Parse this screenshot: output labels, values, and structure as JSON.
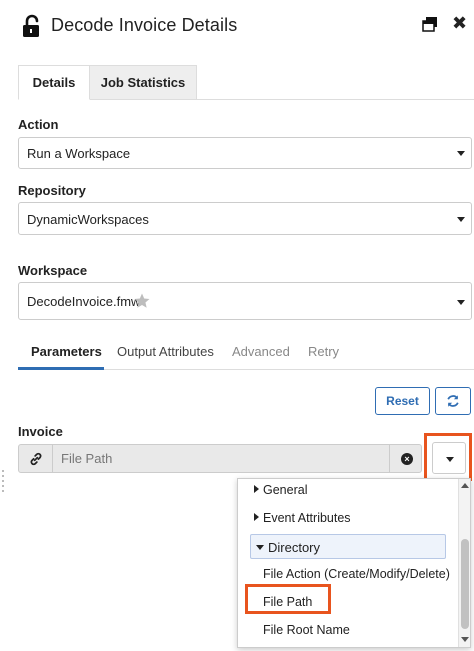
{
  "header": {
    "title": "Decode Invoice Details",
    "lock_icon": "lock-open-icon",
    "restore_icon": "window-restore-icon",
    "close_icon": "close-icon",
    "close_glyph": "✖"
  },
  "tabs": {
    "details": "Details",
    "job_statistics": "Job Statistics"
  },
  "form": {
    "action_label": "Action",
    "action_value": "Run a Workspace",
    "repository_label": "Repository",
    "repository_value": "DynamicWorkspaces",
    "workspace_label": "Workspace",
    "workspace_value": "DecodeInvoice.fmw"
  },
  "subtabs": {
    "parameters": "Parameters",
    "output_attributes": "Output Attributes",
    "advanced": "Advanced",
    "retry": "Retry"
  },
  "buttons": {
    "reset": "Reset",
    "refresh_icon": "refresh-icon"
  },
  "invoice": {
    "label": "Invoice",
    "placeholder": "File Path",
    "link_icon": "link-icon",
    "clear_icon": "clear-circle-icon"
  },
  "dropdown": {
    "general": "General",
    "event_attributes": "Event Attributes",
    "directory": "Directory",
    "file_action": "File Action (Create/Modify/Delete)",
    "file_path": "File Path",
    "file_root_name": "File Root Name"
  },
  "colors": {
    "accent": "#2f6db3",
    "highlight": "#e8541e"
  }
}
